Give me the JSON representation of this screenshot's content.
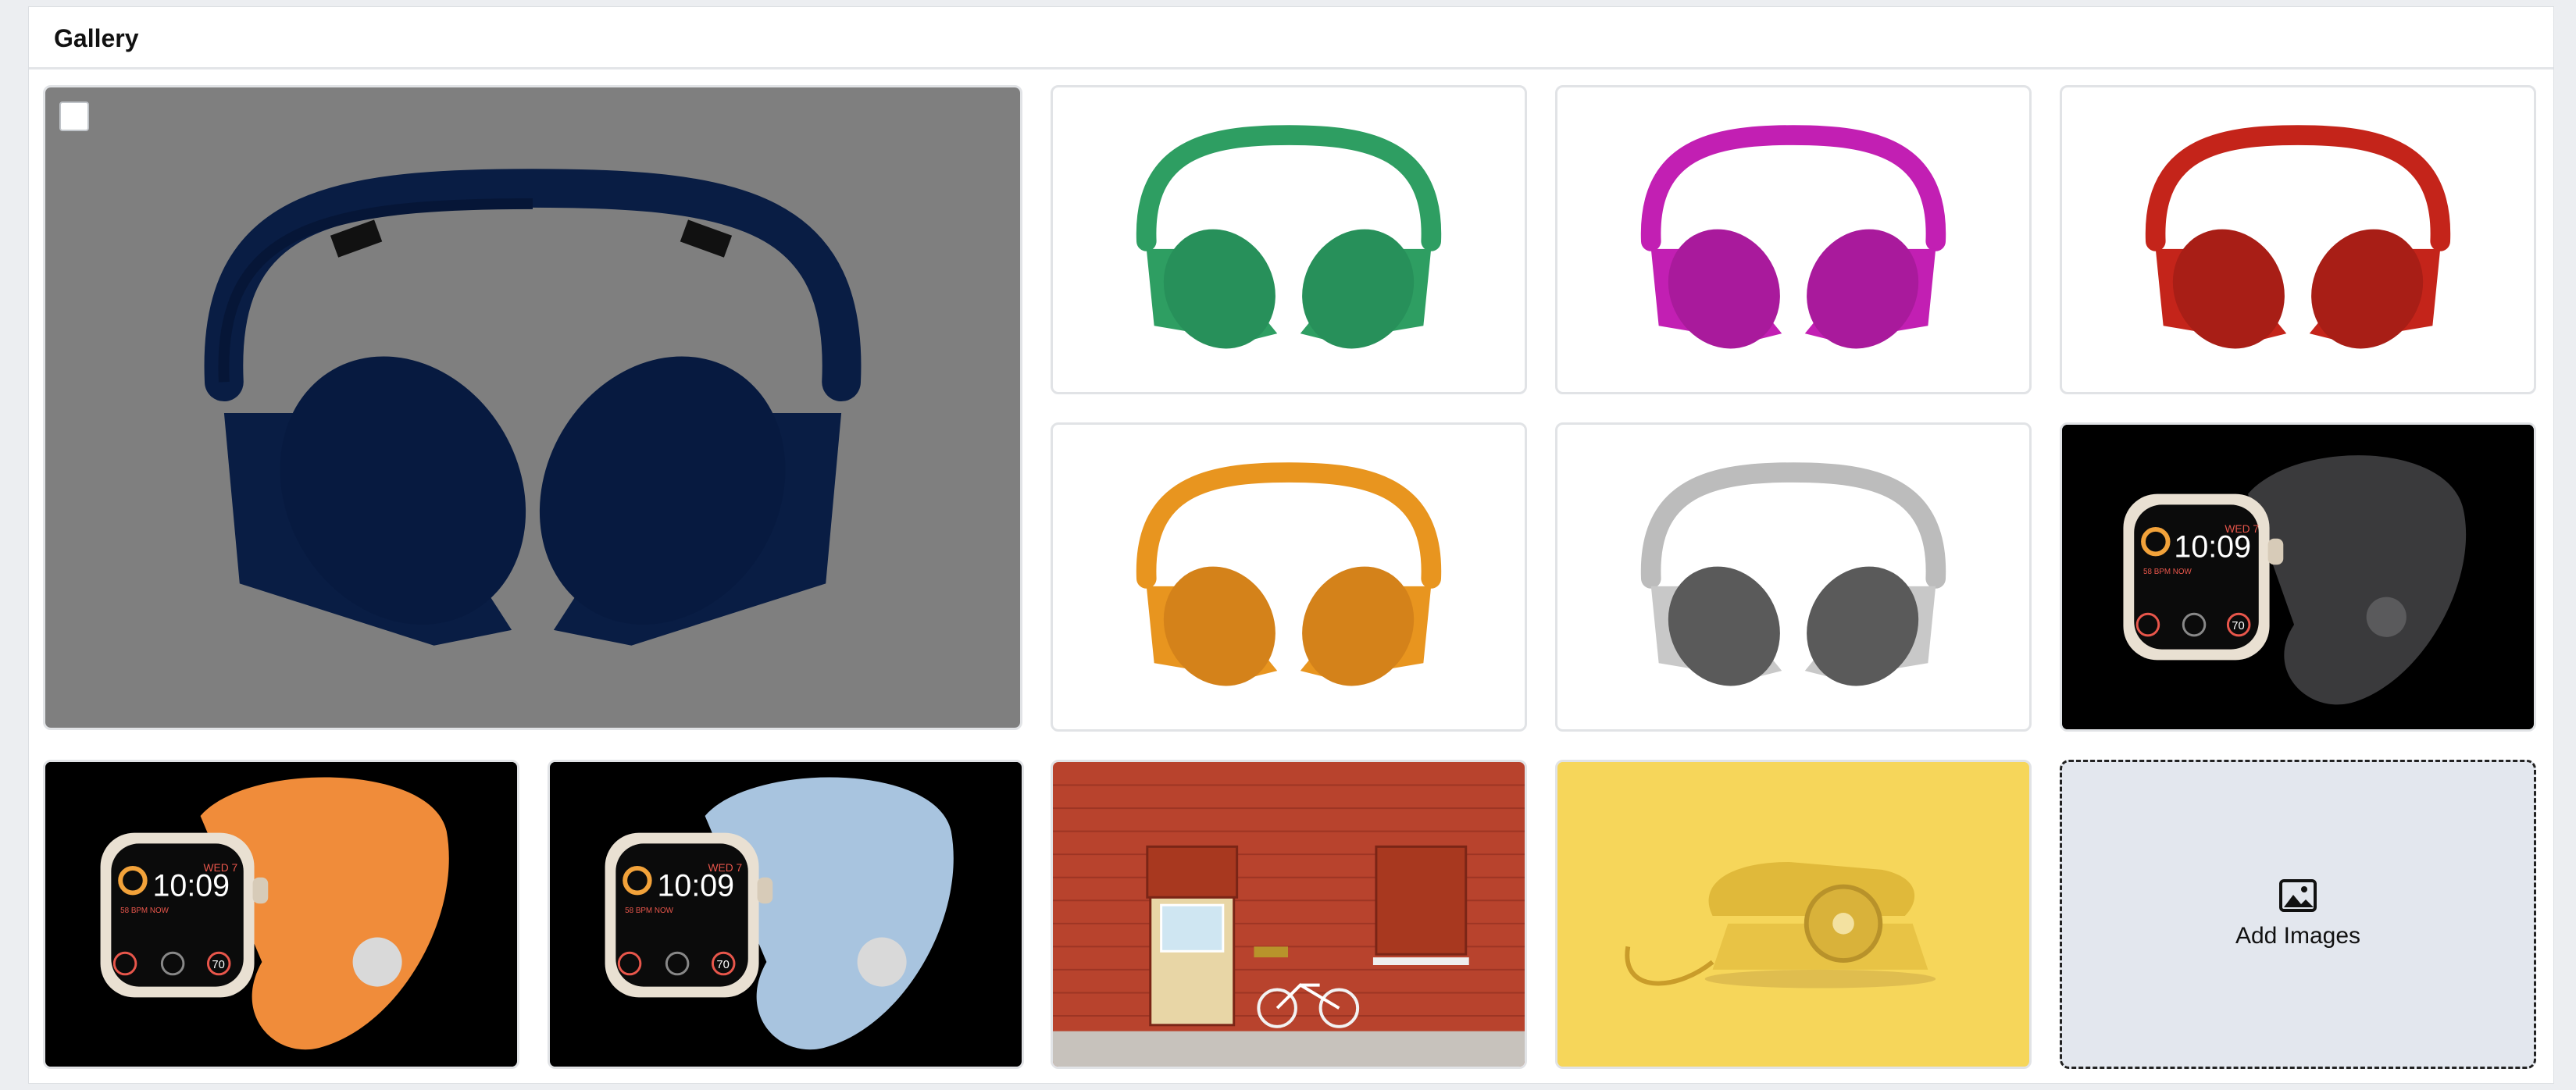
{
  "gallery": {
    "title": "Gallery",
    "add_label": "Add Images",
    "headphone_colors": {
      "featured": "#123a88",
      "green": "#2e9e62",
      "magenta": "#c21fb3",
      "red": "#c4241a",
      "orange": "#e8951f",
      "silver": "#bcbcbc"
    },
    "watch": {
      "day": "WED 7",
      "time": "10:09",
      "bpm": "58 BPM NOW",
      "ring": "70",
      "band_black": "#3a3a3c",
      "band_orange": "#f08c3a",
      "band_blue": "#a8c4df"
    }
  }
}
